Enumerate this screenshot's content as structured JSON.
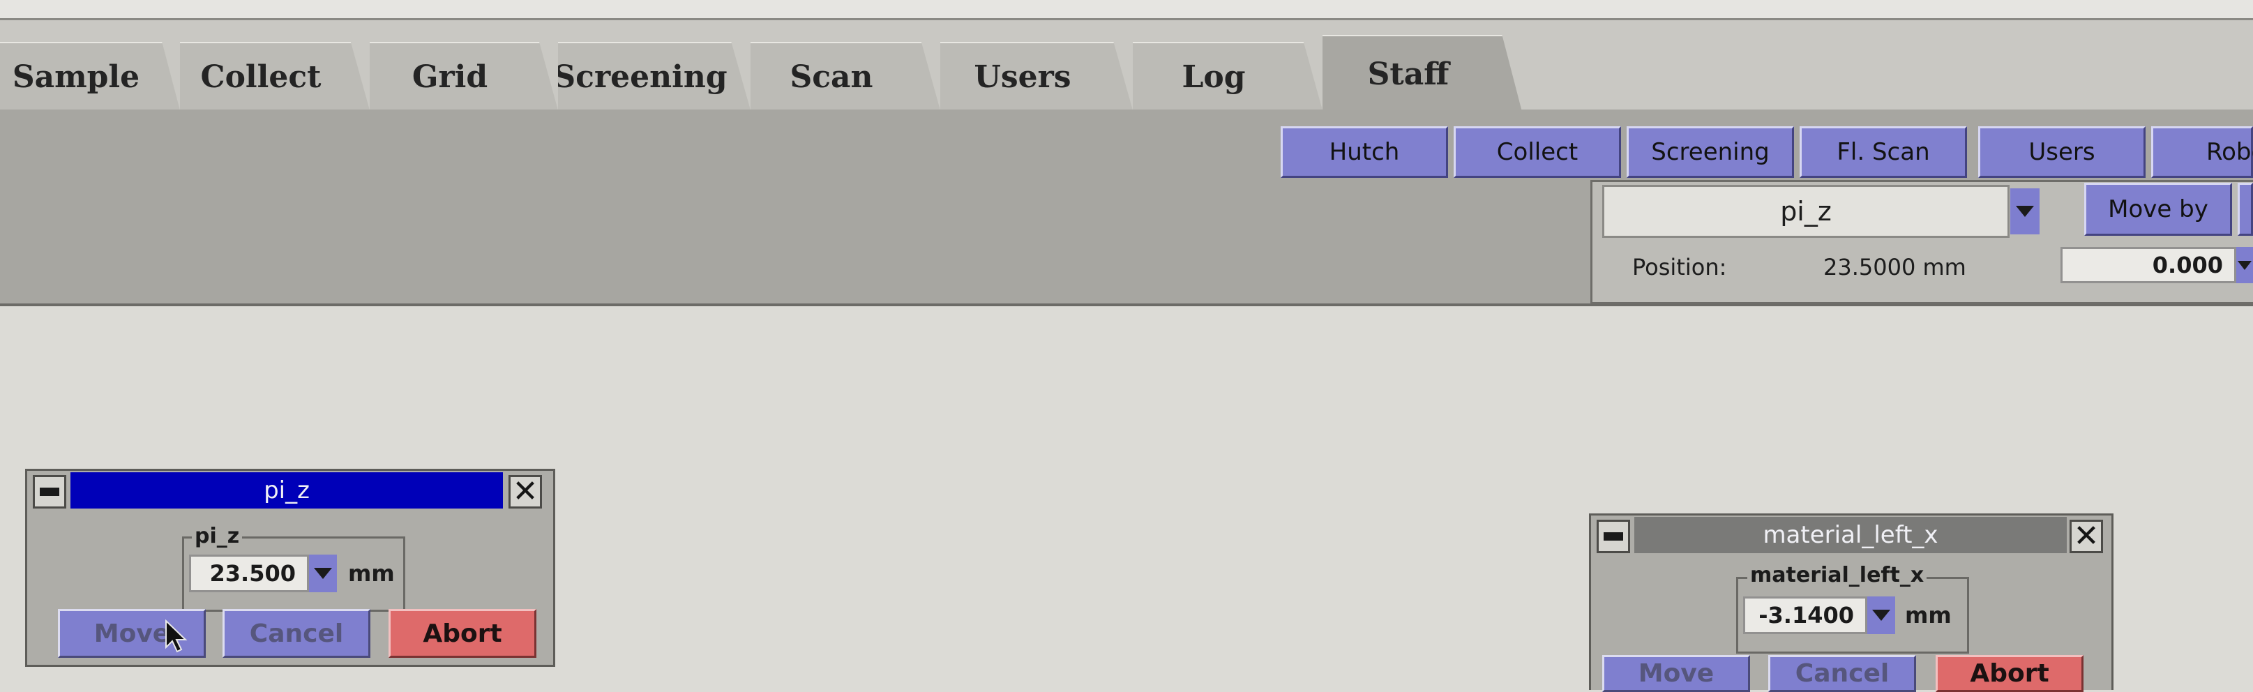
{
  "tabs": [
    {
      "label": "Sample",
      "active": false
    },
    {
      "label": "Collect",
      "active": false
    },
    {
      "label": "Grid",
      "active": false
    },
    {
      "label": "Screening",
      "active": false
    },
    {
      "label": "Scan",
      "active": false
    },
    {
      "label": "Users",
      "active": false
    },
    {
      "label": "Log",
      "active": false
    },
    {
      "label": "Staff",
      "active": true
    }
  ],
  "toolbar": {
    "buttons": [
      "Hutch",
      "Collect",
      "Screening",
      "Fl. Scan",
      "Users",
      "Robo"
    ]
  },
  "motor_panel": {
    "selected_motor": "pi_z",
    "move_by_label": "Move by",
    "position_label": "Position:",
    "position_value": "23.5000 mm",
    "increment_value": "0.000"
  },
  "windows": {
    "pi_z": {
      "title": "pi_z",
      "group_label": "pi_z",
      "value": "23.500",
      "unit": "mm",
      "move_label": "Move",
      "cancel_label": "Cancel",
      "abort_label": "Abort"
    },
    "material_left_x": {
      "title": "material_left_x",
      "group_label": "material_left_x",
      "value": "-3.1400",
      "unit": "mm",
      "move_label": "Move",
      "cancel_label": "Cancel",
      "abort_label": "Abort"
    }
  },
  "colors": {
    "active_title": "#0000b8",
    "inactive_title": "#7a7a78",
    "button_blue": "#7f7fcf",
    "button_red": "#de6a6a"
  }
}
